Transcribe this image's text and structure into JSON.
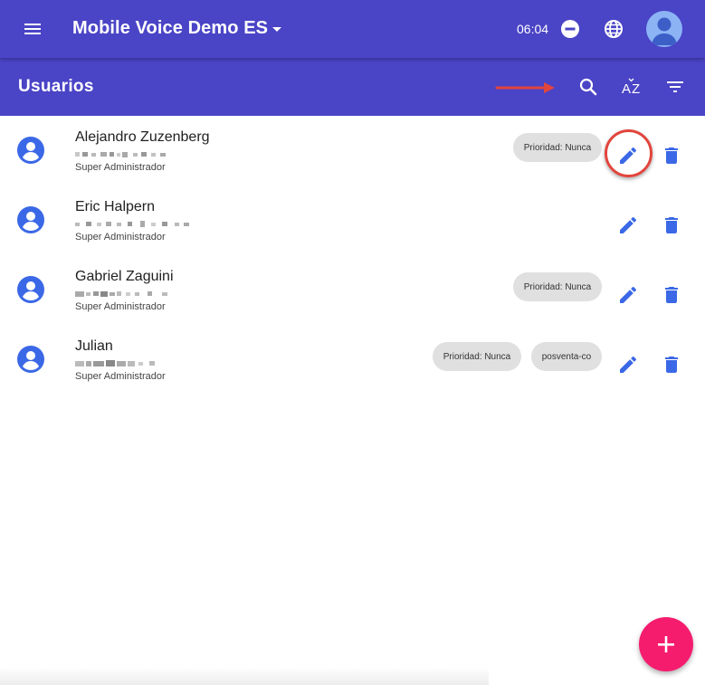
{
  "app": {
    "title": "Mobile Voice Demo ES",
    "time": "06:04",
    "accent_color": "#4a44c6",
    "fab_color": "#f51c6e",
    "icon_color": "#3b68e6"
  },
  "header": {
    "menu_icon": "menu-icon",
    "title_dropdown_icon": "caret-down-icon",
    "status_icon": "do-not-disturb-icon",
    "language_icon": "globe-icon",
    "account_icon": "avatar"
  },
  "toolbar": {
    "heading": "Usuarios",
    "actions": [
      "search-icon",
      "sort-az-icon",
      "filter-icon"
    ]
  },
  "users": [
    {
      "name": "Alejandro Zuzenberg",
      "role": "Super Administrador",
      "chips": [
        "Prioridad: Nunca"
      ]
    },
    {
      "name": "Eric Halpern",
      "role": "Super Administrador",
      "chips": []
    },
    {
      "name": "Gabriel Zaguini",
      "role": "Super Administrador",
      "chips": [
        "Prioridad: Nunca"
      ]
    },
    {
      "name": "Julian",
      "role": "Super Administrador",
      "chips": [
        "Prioridad: Nunca",
        "posventa-co"
      ]
    }
  ],
  "fab": {
    "icon": "add-icon"
  }
}
